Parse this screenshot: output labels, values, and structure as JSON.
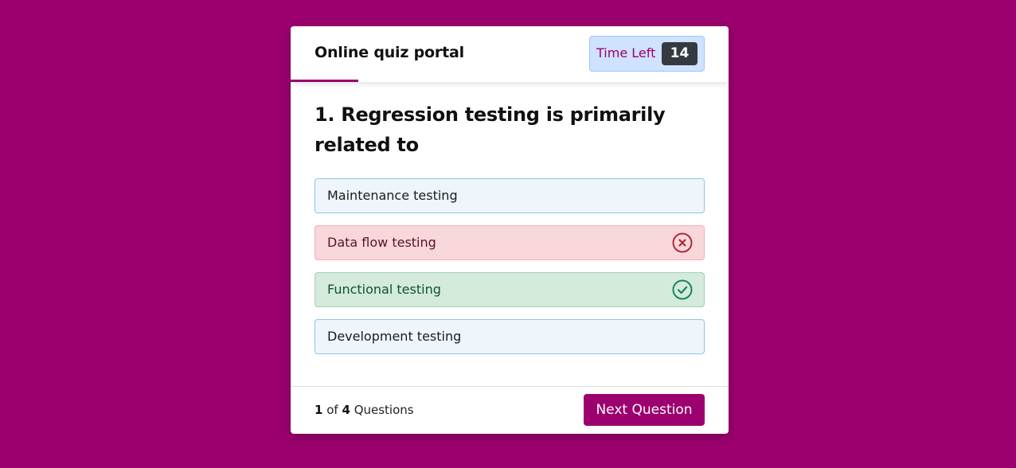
{
  "colors": {
    "page_background": "#9c006f",
    "accent": "#9c006f",
    "timer_label": "#9c006f",
    "correct_icon": "#198754",
    "wrong_icon": "#b02a37"
  },
  "header": {
    "title": "Online quiz portal",
    "timer": {
      "label": "Time Left",
      "value": "14"
    }
  },
  "question": {
    "text": "1. Regression testing is primarily related to",
    "options": [
      {
        "label": "Maintenance testing",
        "state": "neutral",
        "icon": null
      },
      {
        "label": "Data flow testing",
        "state": "wrong",
        "icon": "x-circle-icon"
      },
      {
        "label": "Functional testing",
        "state": "correct",
        "icon": "check-circle-icon"
      },
      {
        "label": "Development testing",
        "state": "neutral",
        "icon": null
      }
    ]
  },
  "footer": {
    "current": "1",
    "of_text": "of",
    "total": "4",
    "questions_text": "Questions",
    "next_label": "Next Question"
  }
}
